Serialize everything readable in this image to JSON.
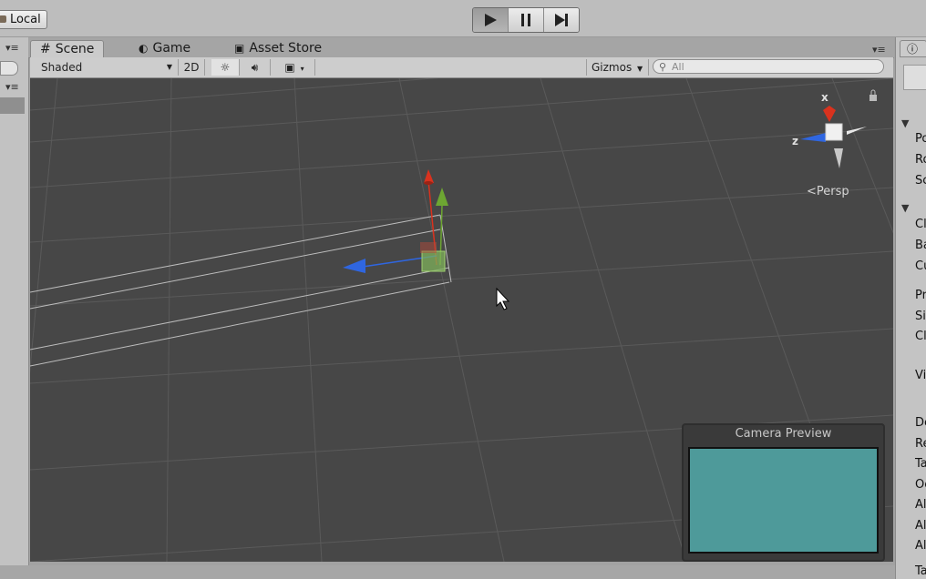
{
  "topbar": {
    "local_label": "Local",
    "play_icon": "play-icon",
    "pause_icon": "pause-icon",
    "step_icon": "step-icon"
  },
  "tabs": [
    {
      "label": "Scene",
      "icon": "hash-icon"
    },
    {
      "label": "Game",
      "icon": "pacman-icon"
    },
    {
      "label": "Asset Store",
      "icon": "store-icon"
    }
  ],
  "toolbar": {
    "shading_mode": "Shaded",
    "mode_2d": "2D",
    "gizmos_label": "Gizmos",
    "search_placeholder": "All"
  },
  "scene": {
    "axis_x": "x",
    "axis_z": "z",
    "projection": "Persp"
  },
  "camera_preview": {
    "title": "Camera Preview",
    "bg_color": "#4e9a9a"
  },
  "inspector": {
    "labels": [
      "Po",
      "Ro",
      "Sc",
      "Cl",
      "Ba",
      "Cu",
      "Pr",
      "Si",
      "Cl",
      "Vi",
      "De",
      "Re",
      "Ta",
      "Oc",
      "Al",
      "Al",
      "Al",
      "Ta"
    ]
  },
  "colors": {
    "scene_bg": "#474747",
    "axis_x": "#d9321e",
    "axis_y": "#6da632",
    "axis_z": "#2f66e0"
  }
}
